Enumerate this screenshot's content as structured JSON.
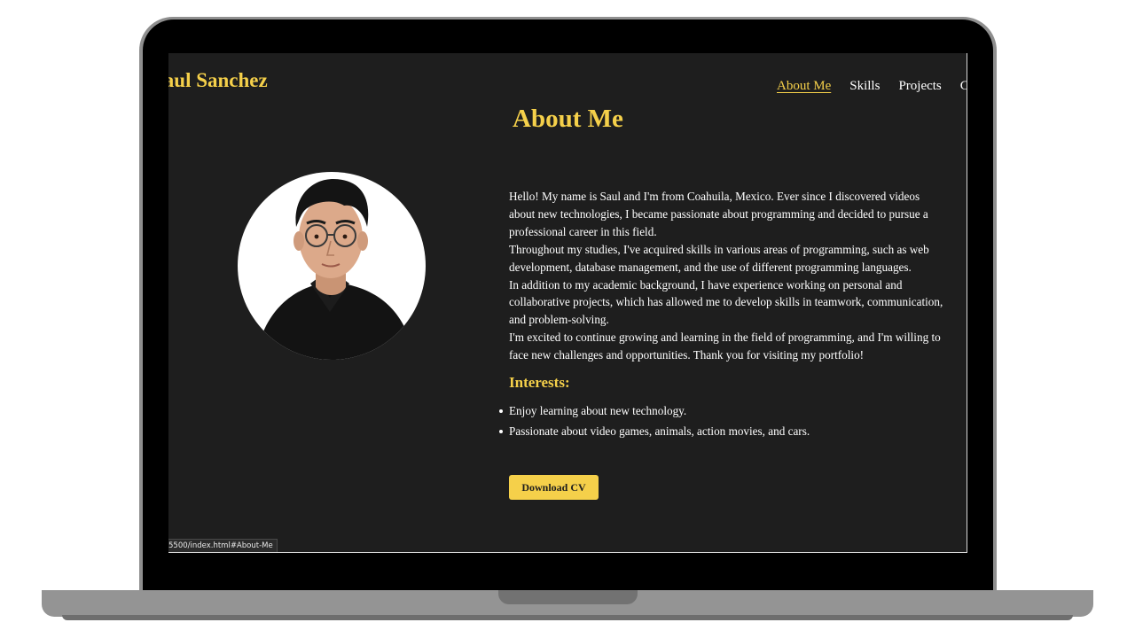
{
  "header": {
    "brand": "Saul Sanchez",
    "nav": [
      {
        "label": "About Me",
        "active": true
      },
      {
        "label": "Skills",
        "active": false
      },
      {
        "label": "Projects",
        "active": false
      },
      {
        "label": "Contact",
        "active": false
      }
    ]
  },
  "about": {
    "title": "About Me",
    "avatar_icon": "profile-photo",
    "paragraphs": [
      "Hello! My name is Saul and I'm from Coahuila, Mexico. Ever since I discovered videos about new technologies, I became passionate about programming and decided to pursue a professional career in this field.",
      "Throughout my studies, I've acquired skills in various areas of programming, such as web development, database management, and the use of different programming languages.",
      "In addition to my academic background, I have experience working on personal and collaborative projects, which has allowed me to develop skills in teamwork, communication, and problem-solving.",
      "I'm excited to continue growing and learning in the field of programming, and I'm willing to face new challenges and opportunities. Thank you for visiting my portfolio!"
    ],
    "interests_title": "Interests:",
    "interests": [
      "Enjoy learning about new technology.",
      "Passionate about video games, animals, action movies, and cars."
    ],
    "cv_button": "Download CV"
  },
  "status_bar": {
    "url": "5500/index.html#About-Me"
  },
  "colors": {
    "accent": "#f5d04a",
    "background": "#1e1e1e",
    "text": "#ffffff"
  }
}
